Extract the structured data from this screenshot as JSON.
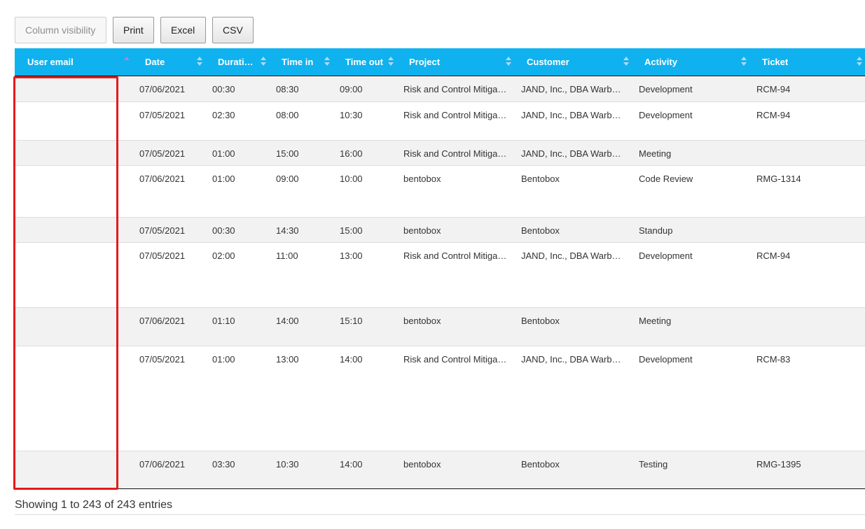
{
  "toolbar": {
    "column_visibility": "Column visibility",
    "print": "Print",
    "excel": "Excel",
    "csv": "CSV"
  },
  "table": {
    "headers": {
      "user_email": "User email",
      "date": "Date",
      "duration": "Durati…",
      "time_in": "Time in",
      "time_out": "Time out",
      "project": "Project",
      "customer": "Customer",
      "activity": "Activity",
      "ticket": "Ticket"
    },
    "sorted_column": "User email",
    "sort_direction": "ascending",
    "rows": [
      {
        "user_email": "",
        "date": "07/06/2021",
        "duration": "00:30",
        "time_in": "08:30",
        "time_out": "09:00",
        "project": "Risk and Control Mitiga…",
        "customer": "JAND, Inc., DBA Warb…",
        "activity": "Development",
        "ticket": "RCM-94"
      },
      {
        "user_email": "",
        "date": "07/05/2021",
        "duration": "02:30",
        "time_in": "08:00",
        "time_out": "10:30",
        "project": "Risk and Control Mitiga…",
        "customer": "JAND, Inc., DBA Warb…",
        "activity": "Development",
        "ticket": "RCM-94"
      },
      {
        "user_email": "",
        "date": "07/05/2021",
        "duration": "01:00",
        "time_in": "15:00",
        "time_out": "16:00",
        "project": "Risk and Control Mitiga…",
        "customer": "JAND, Inc., DBA Warb…",
        "activity": "Meeting",
        "ticket": ""
      },
      {
        "user_email": "",
        "date": "07/06/2021",
        "duration": "01:00",
        "time_in": "09:00",
        "time_out": "10:00",
        "project": "bentobox",
        "customer": "Bentobox",
        "activity": "Code Review",
        "ticket": "RMG-1314"
      },
      {
        "user_email": "",
        "date": "07/05/2021",
        "duration": "00:30",
        "time_in": "14:30",
        "time_out": "15:00",
        "project": "bentobox",
        "customer": "Bentobox",
        "activity": "Standup",
        "ticket": ""
      },
      {
        "user_email": "",
        "date": "07/05/2021",
        "duration": "02:00",
        "time_in": "11:00",
        "time_out": "13:00",
        "project": "Risk and Control Mitiga…",
        "customer": "JAND, Inc., DBA Warb…",
        "activity": "Development",
        "ticket": "RCM-94"
      },
      {
        "user_email": "",
        "date": "07/06/2021",
        "duration": "01:10",
        "time_in": "14:00",
        "time_out": "15:10",
        "project": "bentobox",
        "customer": "Bentobox",
        "activity": "Meeting",
        "ticket": ""
      },
      {
        "user_email": "",
        "date": "07/05/2021",
        "duration": "01:00",
        "time_in": "13:00",
        "time_out": "14:00",
        "project": "Risk and Control Mitiga…",
        "customer": "JAND, Inc., DBA Warb…",
        "activity": "Development",
        "ticket": "RCM-83"
      },
      {
        "user_email": "",
        "date": "07/06/2021",
        "duration": "03:30",
        "time_in": "10:30",
        "time_out": "14:00",
        "project": "bentobox",
        "customer": "Bentobox",
        "activity": "Testing",
        "ticket": "RMG-1395"
      }
    ]
  },
  "info": "Showing 1 to 243 of 243 entries",
  "colors": {
    "header_bg": "#0fb2ee",
    "highlight": "#e61a1a",
    "odd_row": "#f2f2f2"
  }
}
